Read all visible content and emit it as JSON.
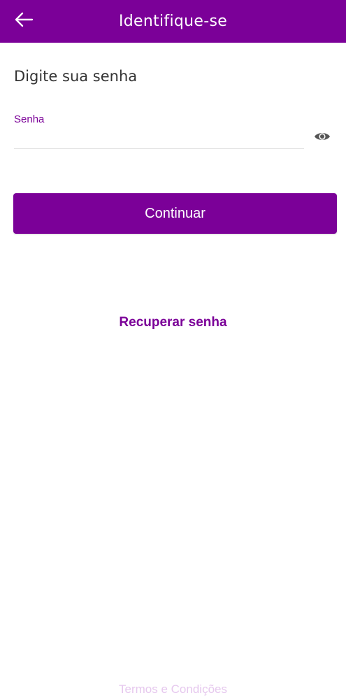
{
  "colors": {
    "brand": "#7b0098",
    "heading_text": "#333333",
    "underline": "#dcdcdc",
    "eye_icon": "#555555",
    "footer_text": "#e6c8ee"
  },
  "header": {
    "title": "Identifique-se",
    "back_icon": "arrow-left-icon"
  },
  "form": {
    "heading": "Digite sua senha",
    "password_label": "Senha",
    "password_value": "",
    "visibility_icon": "eye-icon"
  },
  "actions": {
    "continue_label": "Continuar",
    "recover_label": "Recuperar senha"
  },
  "footer": {
    "terms_label": "Termos e Condições"
  }
}
